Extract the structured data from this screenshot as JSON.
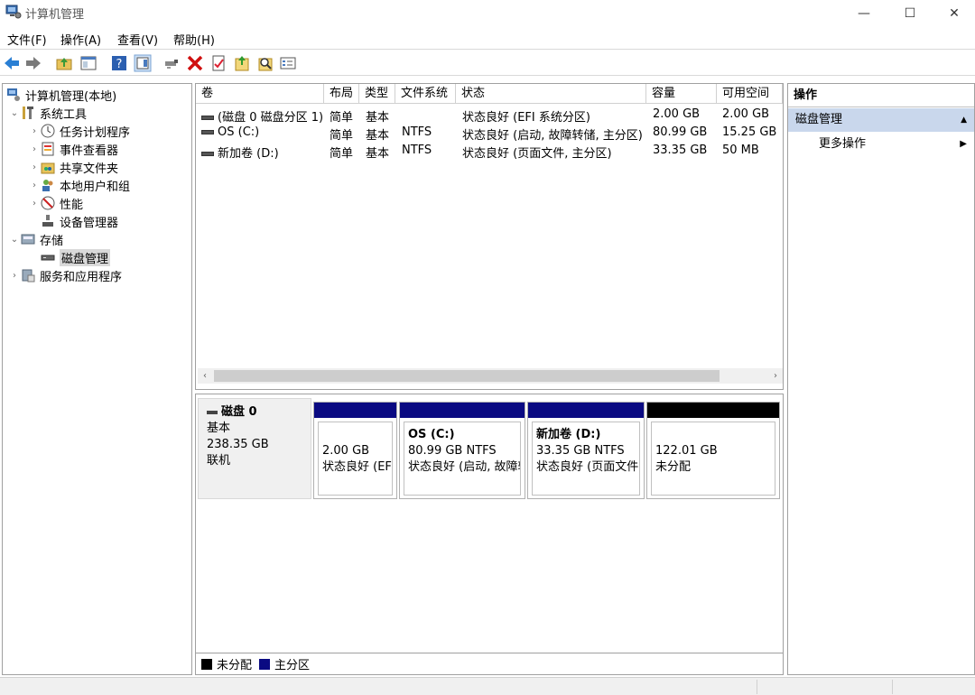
{
  "window": {
    "title": "计算机管理",
    "controls": [
      "—",
      "☐",
      "✕"
    ]
  },
  "menu": [
    "文件(F)",
    "操作(A)",
    "查看(V)",
    "帮助(H)"
  ],
  "toolbar": [
    "back-icon",
    "forward-icon",
    "up-folder-icon",
    "show-tree-icon",
    "help-icon",
    "show-action-pane-icon",
    "connect-icon",
    "delete-icon",
    "properties-icon",
    "export-icon",
    "search-icon",
    "settings-icon"
  ],
  "tree": {
    "root": "计算机管理(本地)",
    "items": [
      {
        "label": "系统工具",
        "chev": "⌄",
        "icon": "tools-icon"
      },
      {
        "label": "任务计划程序",
        "chev": "›",
        "icon": "clock-icon"
      },
      {
        "label": "事件查看器",
        "chev": "›",
        "icon": "event-viewer-icon"
      },
      {
        "label": "共享文件夹",
        "chev": "›",
        "icon": "shared-folder-icon"
      },
      {
        "label": "本地用户和组",
        "chev": "›",
        "icon": "users-icon"
      },
      {
        "label": "性能",
        "chev": "›",
        "icon": "performance-icon"
      },
      {
        "label": "设备管理器",
        "chev": "",
        "icon": "device-manager-icon"
      },
      {
        "label": "存储",
        "chev": "⌄",
        "icon": "storage-icon"
      },
      {
        "label": "磁盘管理",
        "chev": "",
        "icon": "disk-icon"
      },
      {
        "label": "服务和应用程序",
        "chev": "›",
        "icon": "services-icon"
      }
    ]
  },
  "volume_table": {
    "columns": [
      "卷",
      "布局",
      "类型",
      "文件系统",
      "状态",
      "容量",
      "可用空间"
    ],
    "rows": [
      [
        "(磁盘 0 磁盘分区 1)",
        "简单",
        "基本",
        "",
        "状态良好 (EFI 系统分区)",
        "2.00 GB",
        "2.00 GB"
      ],
      [
        "OS (C:)",
        "简单",
        "基本",
        "NTFS",
        "状态良好 (启动, 故障转储, 主分区)",
        "80.99 GB",
        "15.25 GB"
      ],
      [
        "新加卷 (D:)",
        "简单",
        "基本",
        "NTFS",
        "状态良好 (页面文件, 主分区)",
        "33.35 GB",
        "50 MB"
      ]
    ],
    "scroll_left": "‹",
    "scroll_right": "›"
  },
  "disk": {
    "name": "磁盘 0",
    "type": "基本",
    "size": "238.35 GB",
    "status": "联机",
    "partitions": [
      {
        "name": "",
        "size": "2.00 GB",
        "status": "状态良好 (EFI",
        "bar_color": "#0a0a82"
      },
      {
        "name": "OS  (C:)",
        "size": "80.99 GB NTFS",
        "status": "状态良好 (启动, 故障转",
        "bar_color": "#0a0a82"
      },
      {
        "name": "新加卷  (D:)",
        "size": "33.35 GB NTFS",
        "status": "状态良好 (页面文件",
        "bar_color": "#0a0a82"
      },
      {
        "name": "",
        "size": "122.01 GB",
        "status": "未分配",
        "bar_color": "#000000"
      }
    ]
  },
  "legend": [
    {
      "label": "未分配",
      "color": "#000000"
    },
    {
      "label": "主分区",
      "color": "#0a0a82"
    }
  ],
  "actions": {
    "header": "操作",
    "section": "磁盘管理",
    "section_arrow": "▲",
    "item": "更多操作",
    "item_arrow": "▶"
  }
}
